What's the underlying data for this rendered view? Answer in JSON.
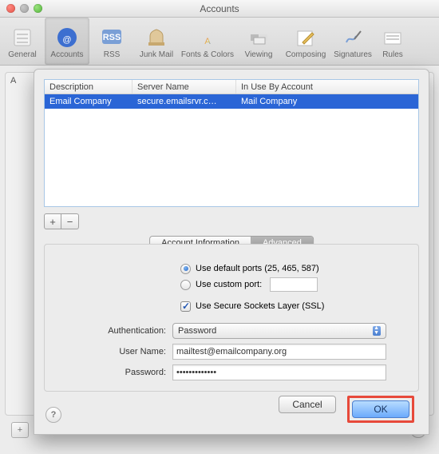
{
  "window": {
    "title": "Accounts"
  },
  "toolbar": {
    "items": [
      {
        "label": "General"
      },
      {
        "label": "Accounts"
      },
      {
        "label": "RSS"
      },
      {
        "label": "Junk Mail"
      },
      {
        "label": "Fonts & Colors"
      },
      {
        "label": "Viewing"
      },
      {
        "label": "Composing"
      },
      {
        "label": "Signatures"
      },
      {
        "label": "Rules"
      }
    ]
  },
  "bg_header": "A",
  "table": {
    "columns": [
      "Description",
      "Server Name",
      "In Use By Account"
    ],
    "rows": [
      {
        "description": "Email Company",
        "server": "secure.emailsrvr.c…",
        "account": "Mail Company"
      }
    ]
  },
  "segmented": {
    "info_label": "Account Information",
    "advanced_label": "Advanced"
  },
  "ports": {
    "default_label": "Use default ports (25, 465, 587)",
    "custom_label": "Use custom port:",
    "custom_value": ""
  },
  "ssl_label": "Use Secure Sockets Layer (SSL)",
  "auth": {
    "label": "Authentication:",
    "value": "Password"
  },
  "username": {
    "label": "User Name:",
    "value": "mailtest@emailcompany.org"
  },
  "password": {
    "label": "Password:",
    "value": "•••••••••••••"
  },
  "buttons": {
    "cancel": "Cancel",
    "ok": "OK"
  },
  "glyphs": {
    "plus": "+",
    "minus": "−",
    "question": "?"
  }
}
